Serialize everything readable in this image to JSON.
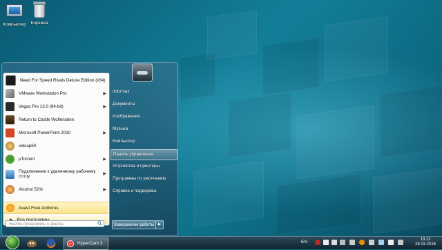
{
  "desktop": {
    "icons": [
      {
        "label": "Компьютер",
        "icon": "computer-icon"
      },
      {
        "label": "Корзина",
        "icon": "recycle-bin-icon"
      }
    ]
  },
  "start_menu": {
    "programs": [
      {
        "label": "Need For Speed Rivals Deluxe Edition (x64)",
        "icon": "nfs-icon",
        "color": "#1a1a1a",
        "has_arrow": false
      },
      {
        "label": "VMware Workstation Pro",
        "icon": "vmware-icon",
        "color": "#6d6d6d",
        "has_arrow": true
      },
      {
        "label": "Vegas Pro 13.0 (64-bit)",
        "icon": "vegas-icon",
        "color": "#2a2a2a",
        "has_arrow": true
      },
      {
        "label": "Return to Castle Wolfenstein",
        "icon": "wolfenstein-icon",
        "color": "#3b2a1a",
        "has_arrow": false
      },
      {
        "label": "Microsoft PowerPoint 2010",
        "icon": "powerpoint-icon",
        "color": "#d24726",
        "has_arrow": true
      },
      {
        "label": "vidcap60",
        "icon": "vidcap-icon",
        "color": "#c89b3c",
        "has_arrow": false
      },
      {
        "label": "µTorrent",
        "icon": "utorrent-icon",
        "color": "#4aa02c",
        "has_arrow": true
      },
      {
        "label": "Подключение к удаленному рабочему столу",
        "icon": "remote-desktop-icon",
        "color": "#3a74b8",
        "has_arrow": true
      },
      {
        "label": "Alcohol 52%",
        "icon": "alcohol-icon",
        "color": "#b84a2a",
        "has_arrow": true
      }
    ],
    "avast": {
      "label": "Avast Free Antivirus",
      "icon": "avast-icon",
      "color": "#f28c00"
    },
    "all_programs": "Все программы",
    "search_placeholder": "Найти программы и файлы",
    "places": [
      "dobrmax",
      "Документы",
      "Изображения",
      "Музыка",
      "Компьютер",
      "Панель управления",
      "Устройства и принтеры",
      "Программы по умолчанию",
      "Справка и поддержка"
    ],
    "highlighted_place": "Панель управления",
    "shutdown": "Завершение работы"
  },
  "taskbar": {
    "pinned": [
      {
        "name": "gimp-icon"
      },
      {
        "name": "firefox-icon"
      },
      {
        "name": "opera-icon"
      }
    ],
    "active_window": "HyperCam 3",
    "language": "EN",
    "time": "13:12",
    "date": "28.03.2016"
  }
}
